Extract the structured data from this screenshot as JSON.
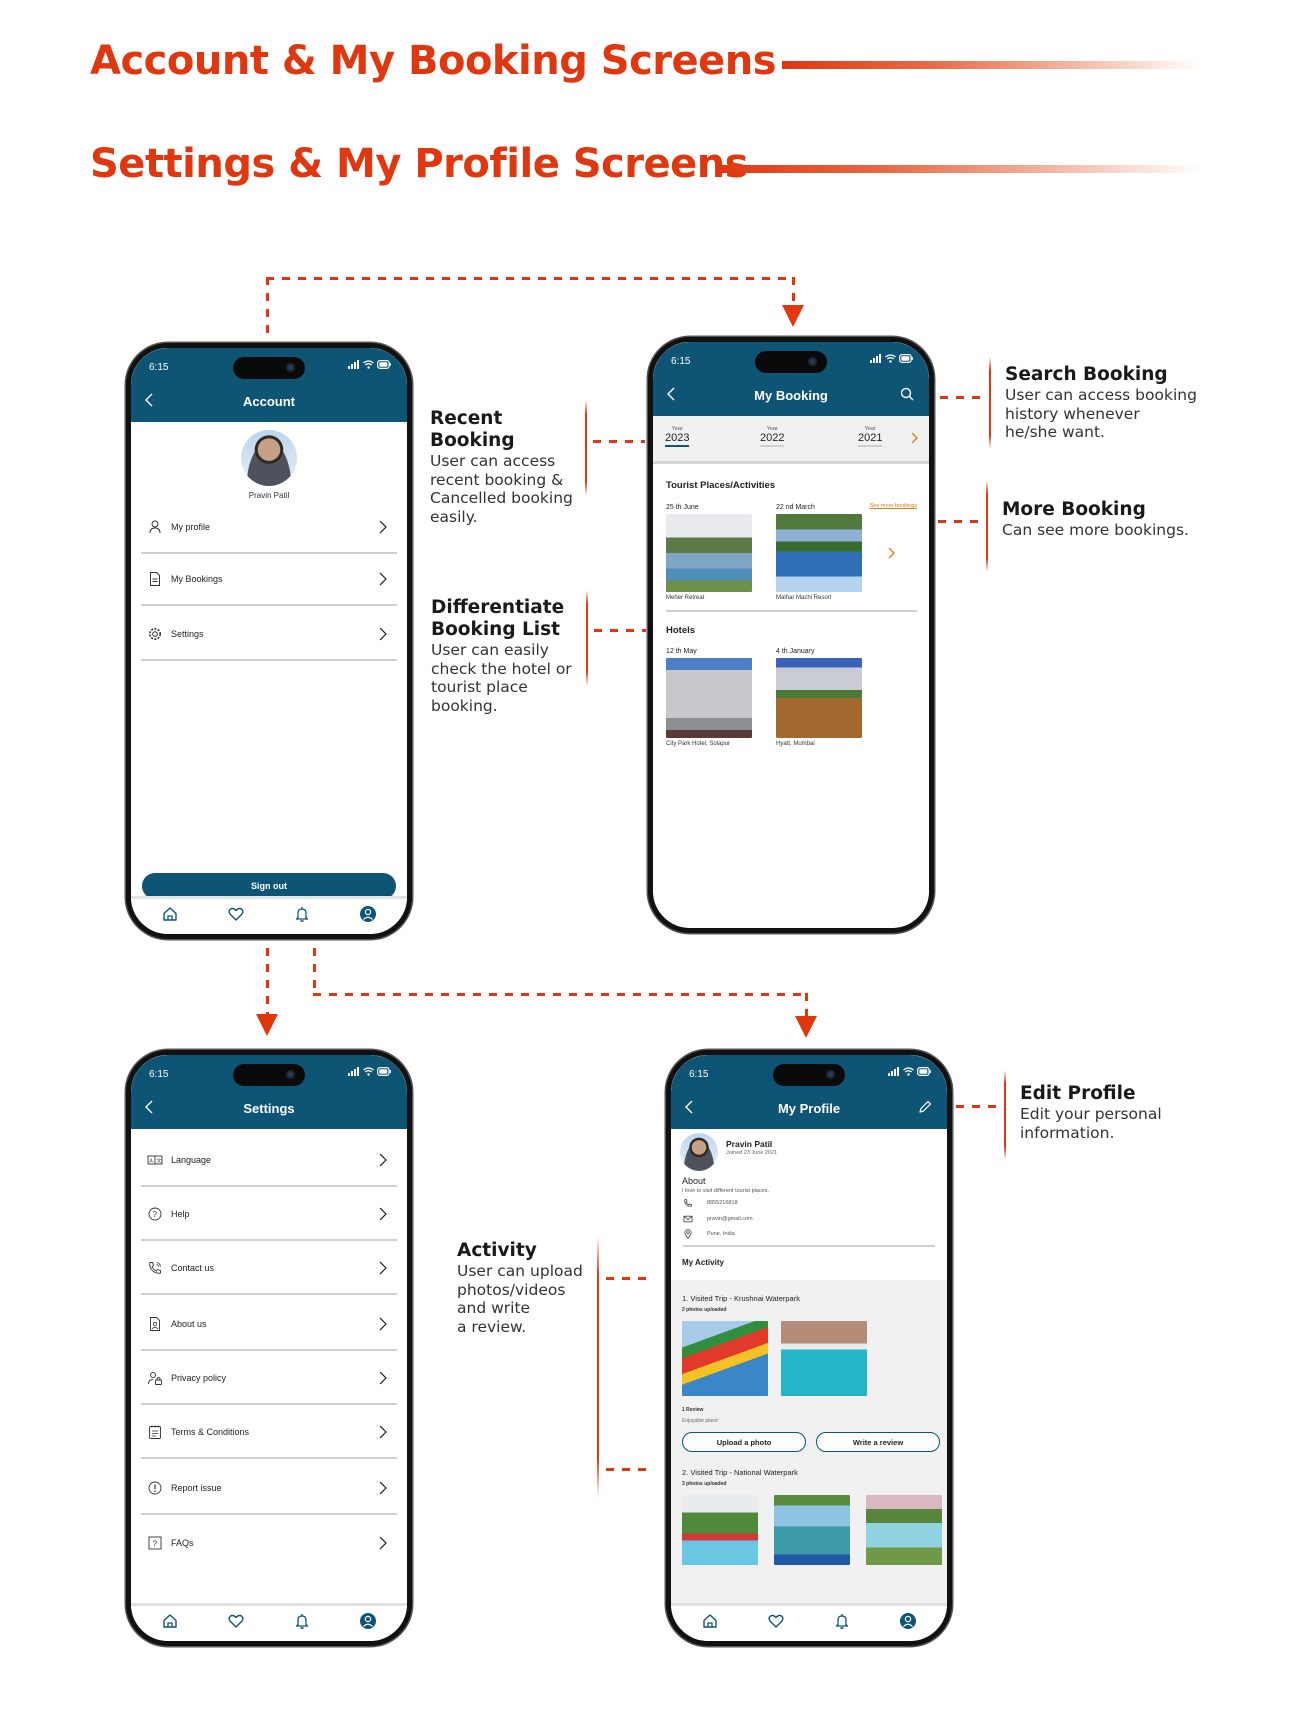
{
  "titles": {
    "section1": "Account & My Booking Screens",
    "section2": "Settings & My Profile Screens"
  },
  "colors": {
    "accent": "#e0370f",
    "header": "#0e5475",
    "link_orange": "#e07a12"
  },
  "status_bar": {
    "time": "6:15"
  },
  "account": {
    "title": "Account",
    "user_name": "Pravin Patil",
    "menu": [
      {
        "label": "My profile",
        "icon": "user-icon"
      },
      {
        "label": "My Bookings",
        "icon": "document-icon"
      },
      {
        "label": "Settings",
        "icon": "gear-icon"
      }
    ],
    "sign_out": "Sign out"
  },
  "booking": {
    "title": "My Booking",
    "year_label": "Year",
    "years": [
      "2023",
      "2022",
      "2021"
    ],
    "selected_year": "2023",
    "tourist_heading": "Tourist Places/Activities",
    "see_more": "See more bookings",
    "tourist": [
      {
        "date": "25 th June",
        "name": "Meher Retreat"
      },
      {
        "date": "22 nd March",
        "name": "Malhar Machi Resort"
      }
    ],
    "hotels_heading": "Hotels",
    "hotels": [
      {
        "date": "12 th May",
        "name": "City Park Hotel, Solapur"
      },
      {
        "date": "4 th January",
        "name": "Hyatt, Mumbai"
      }
    ]
  },
  "settings": {
    "title": "Settings",
    "items": [
      {
        "label": "Language",
        "icon": "language-icon"
      },
      {
        "label": "Help",
        "icon": "help-icon"
      },
      {
        "label": "Contact us",
        "icon": "phone-icon"
      },
      {
        "label": "About us",
        "icon": "about-icon"
      },
      {
        "label": "Privacy policy",
        "icon": "privacy-icon"
      },
      {
        "label": "Terms & Conditions",
        "icon": "terms-icon"
      },
      {
        "label": "Report issue",
        "icon": "alert-icon"
      },
      {
        "label": "FAQs",
        "icon": "faq-icon"
      }
    ]
  },
  "profile": {
    "title": "My Profile",
    "name": "Pravin Patil",
    "joined": "Joined 23 June 2021",
    "about_heading": "About",
    "about_text": "I love to visit different tourist places.",
    "phone": "8855216818",
    "email": "pravin@gmail.com",
    "location": "Pune, India",
    "activity_heading": "My Activity",
    "trips": [
      {
        "title": "1. Visited Trip - Krushnai Waterpark",
        "photos": "2 photos uploaded",
        "review_count": "1 Review",
        "review_text": "Enjoyable place!"
      },
      {
        "title": "2. Visited Trip - National Waterpark",
        "photos": "3 photos uploaded"
      }
    ],
    "upload_button": "Upload a photo",
    "review_button": "Write a review"
  },
  "annotations": {
    "recent": {
      "heading": "Recent Booking",
      "body": "User can access\nrecent booking &\nCancelled booking\neasily."
    },
    "differentiate": {
      "heading": "Differentiate\nBooking List",
      "body": "User can easily\ncheck the hotel or\ntourist place\nbooking."
    },
    "search": {
      "heading": "Search Booking",
      "body": "User can access booking\nhistory whenever\n he/she want."
    },
    "more": {
      "heading": "More Booking",
      "body": "Can see more bookings."
    },
    "activity": {
      "heading": "Activity",
      "body": "User can upload\nphotos/videos\nand write\na review."
    },
    "edit": {
      "heading": "Edit Profile",
      "body": "Edit your personal\ninformation."
    }
  }
}
